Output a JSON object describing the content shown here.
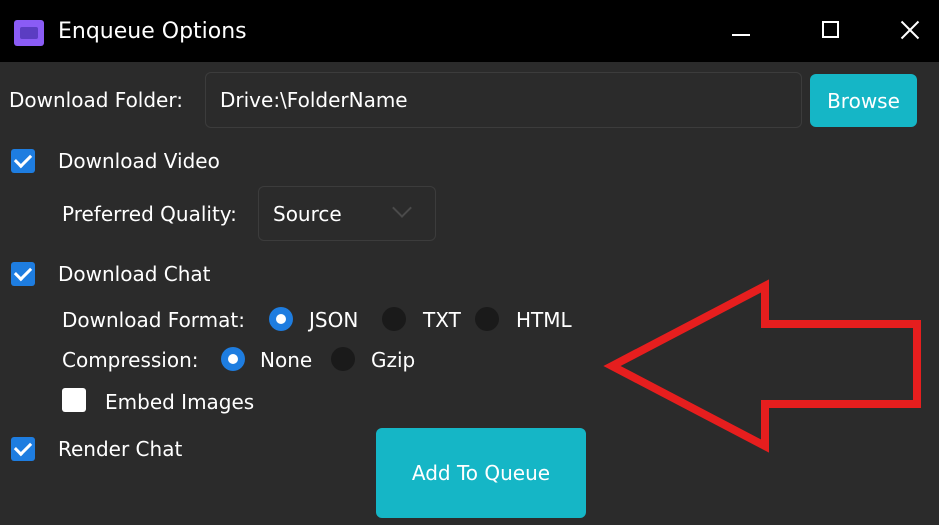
{
  "window": {
    "title": "Enqueue Options"
  },
  "download_folder": {
    "label": "Download Folder:",
    "value": "Drive:\\FolderName",
    "browse_label": "Browse"
  },
  "video": {
    "checkbox_label": "Download Video",
    "checked": true,
    "quality_label": "Preferred Quality:",
    "quality_value": "Source"
  },
  "chat": {
    "checkbox_label": "Download Chat",
    "checked": true,
    "format_label": "Download Format:",
    "format_options": [
      "JSON",
      "TXT",
      "HTML"
    ],
    "format_selected": "JSON",
    "compression_label": "Compression:",
    "compression_options": [
      "None",
      "Gzip"
    ],
    "compression_selected": "None",
    "embed_label": "Embed Images",
    "embed_checked": false
  },
  "render": {
    "checkbox_label": "Render Chat",
    "checked": true
  },
  "actions": {
    "add_label": "Add To Queue"
  },
  "colors": {
    "accent": "#15b6c6",
    "check_blue": "#1e7de0",
    "window_bg": "#2b2b2b",
    "titlebar_bg": "#000000",
    "annotation_arrow": "#e61e1e"
  }
}
